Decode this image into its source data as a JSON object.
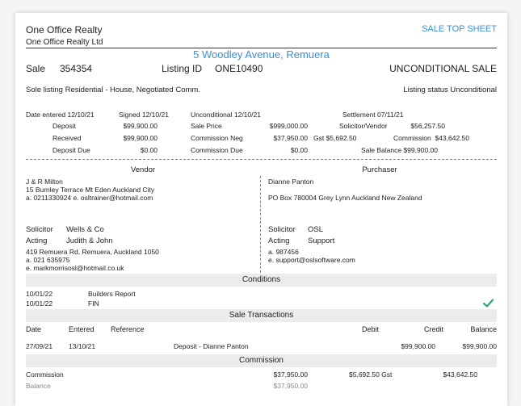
{
  "header": {
    "company": "One Office Realty",
    "company_sub": "One Office Realty Ltd",
    "doc_type": "SALE TOP SHEET",
    "address": "5 Woodley Avenue, Remuera"
  },
  "listing": {
    "sale_label": "Sale",
    "sale_no": "354354",
    "listing_id_label": "Listing ID",
    "listing_id": "ONE10490",
    "status_big": "UNCONDITIONAL SALE",
    "description": "Sole listing Residential  - House, Negotiated Comm.",
    "listing_status": "Listing status Unconditional"
  },
  "dates": {
    "entered": "Date entered  12/10/21",
    "signed": "Signed  12/10/21",
    "unconditional": "Unconditional  12/10/21",
    "settlement": "Settlement  07/11/21"
  },
  "financials": {
    "deposit_label": "Deposit",
    "deposit": "$99,900.00",
    "received_label": "Received",
    "received": "$99,900.00",
    "deposit_due_label": "Deposit Due",
    "deposit_due": "$0.00",
    "sale_price_label": "Sale Price",
    "sale_price": "$999,000.00",
    "comm_neg_label": "Commission Neg",
    "comm_neg": "$37,950.00",
    "gst": "Gst $5,692.50",
    "comm_due_label": "Commission Due",
    "comm_due": "$0.00",
    "solicitor_vendor_label": "Solicitor/Vendor",
    "solicitor_vendor": "$56,257.50",
    "commission_label": "Commission",
    "commission": "$43,642.50",
    "sale_balance": "Sale Balance $99,900.00"
  },
  "vendor": {
    "heading": "Vendor",
    "name": "J & R Milton",
    "address": "15 Burnley Terrace Mt Eden Auckland City",
    "contact": "a. 0211330924 e. osltrainer@hotmail.com",
    "solicitor_label": "Solicitor",
    "solicitor": "Wells & Co",
    "acting_label": "Acting",
    "acting": "Judith & John",
    "sol_address": "419 Remuera Rd, Remuera, Auckland 1050",
    "sol_phone": "a. 021 635975",
    "sol_email": "e. markmorrisosl@hotmail.co.uk"
  },
  "purchaser": {
    "heading": "Purchaser",
    "name": "Dianne Panton",
    "address": "PO Box 780004 Grey Lynn Auckland New Zealand",
    "solicitor_label": "Solicitor",
    "solicitor": "OSL",
    "acting_label": "Acting",
    "acting": "Support",
    "sol_phone": "a. 987456",
    "sol_email": "e. support@oslsoftware.com"
  },
  "conditions": {
    "heading": "Conditions",
    "rows": [
      {
        "date": "10/01/22",
        "label": "Builders Report"
      },
      {
        "date": "10/01/22",
        "label": "FIN"
      }
    ]
  },
  "transactions": {
    "heading": "Sale Transactions",
    "columns": {
      "date": "Date",
      "entered": "Entered",
      "reference": "Reference",
      "debit": "Debit",
      "credit": "Credit",
      "balance": "Balance"
    },
    "rows": [
      {
        "date": "27/09/21",
        "entered": "13/10/21",
        "reference": "Deposit - Dianne Panton",
        "debit": "",
        "credit": "$99,900.00",
        "balance": "$99,900.00"
      }
    ]
  },
  "commission": {
    "heading": "Commission",
    "rows": [
      {
        "label": "Commission",
        "amount": "$37,950.00",
        "gst": "$5,692.50 Gst",
        "total": "$43,642.50"
      },
      {
        "label": "Balance",
        "amount": "$37,950.00",
        "gst": "",
        "total": ""
      }
    ]
  },
  "colors": {
    "accent": "#3a8fd3",
    "check": "#3aa672"
  },
  "icons": {
    "condition_check": "checkmark-icon"
  }
}
